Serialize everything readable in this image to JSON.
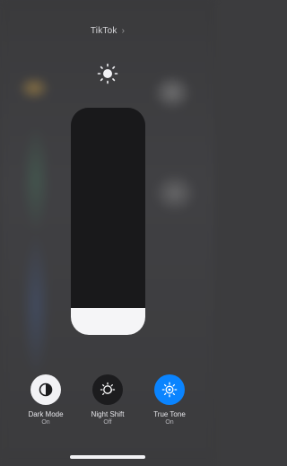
{
  "header": {
    "app_name": "TikTok",
    "chevron_glyph": "›"
  },
  "brightness": {
    "icon": "sun-icon",
    "level": 0.12
  },
  "toggles": [
    {
      "name": "Dark Mode",
      "state": "On",
      "icon": "dark-mode-icon",
      "bg": "#f2f2f5",
      "fg": "#1c1c1e"
    },
    {
      "name": "Night Shift",
      "state": "Off",
      "icon": "night-shift-icon",
      "bg": "#1c1c1e",
      "fg": "#ffffff"
    },
    {
      "name": "True Tone",
      "state": "On",
      "icon": "true-tone-icon",
      "bg": "#0a84ff",
      "fg": "#ffffff"
    }
  ],
  "colors": {
    "slider_track": "#19191b",
    "slider_fill": "#f5f5f7",
    "accent": "#0a84ff"
  }
}
